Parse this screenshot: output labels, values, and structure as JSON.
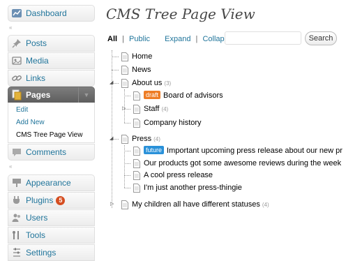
{
  "sidebar": {
    "dashboard": "Dashboard",
    "posts": "Posts",
    "media": "Media",
    "links": "Links",
    "pages": "Pages",
    "pages_sub": [
      "Edit",
      "Add New",
      "CMS Tree Page View"
    ],
    "comments": "Comments",
    "appearance": "Appearance",
    "plugins": "Plugins",
    "plugins_badge": "5",
    "users": "Users",
    "tools": "Tools",
    "settings": "Settings",
    "accent_color": "#21759b",
    "badge_color": "#d54e21"
  },
  "page": {
    "title": "CMS Tree Page View"
  },
  "filters": {
    "all": "All",
    "public": "Public",
    "expand": "Expand",
    "collapse": "Collapse",
    "separator": "|"
  },
  "search": {
    "value": "",
    "button": "Search"
  },
  "tree": {
    "home": {
      "title": "Home"
    },
    "news": {
      "title": "News"
    },
    "about": {
      "title": "About us",
      "count": "(3)"
    },
    "board": {
      "status": "draft",
      "title": "Board of advisors"
    },
    "staff": {
      "title": "Staff",
      "count": "(4)"
    },
    "history": {
      "title": "Company history"
    },
    "press": {
      "title": "Press",
      "count": "(4)"
    },
    "upcoming": {
      "status": "future",
      "title": "Important upcoming press release about our new pr"
    },
    "reviews": {
      "title": "Our products got some awesome reviews during the week"
    },
    "cool": {
      "title": "A cool press release"
    },
    "thingie": {
      "title": "I'm just another press-thingie"
    },
    "children": {
      "title": "My children all have different statuses",
      "count": "(4)"
    }
  }
}
